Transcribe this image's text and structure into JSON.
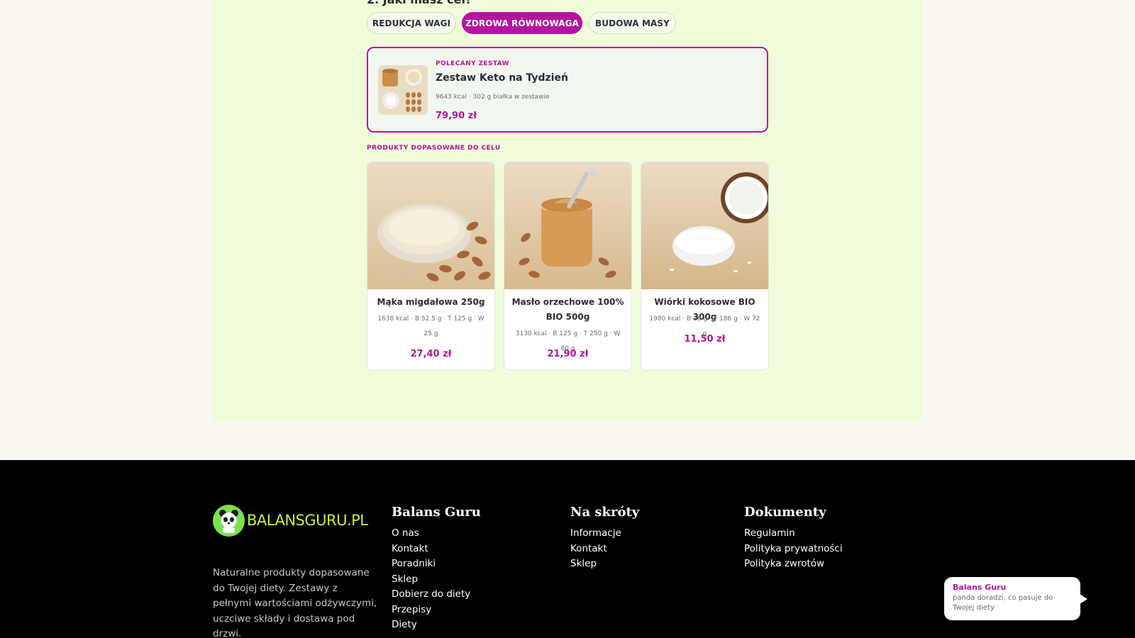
{
  "quiz": {
    "question": "2. Jaki masz cel?",
    "goals": [
      {
        "label": "REDUKCJA WAGI",
        "active": false
      },
      {
        "label": "ZDROWA RÓWNOWAGA",
        "active": true
      },
      {
        "label": "BUDOWA MASY",
        "active": false
      }
    ]
  },
  "featured": {
    "eyebrow": "POLECANY ZESTAW",
    "name": "Zestaw Keto na Tydzień",
    "meta": "9643 kcal · 302 g białka w zestawie",
    "price": "79,90 zł"
  },
  "products_section": {
    "label": "PRODUKTY DOPASOWANE DO CELU",
    "items": [
      {
        "name": "Mąka migdałowa 250g",
        "meta": "1638 kcal · B 52.5 g · T 125 g · W 25 g",
        "price": "27,40 zł",
        "image": "almond-flour-photo"
      },
      {
        "name": "Masło orzechowe 100% BIO 500g",
        "meta": "3130 kcal · B 125 g · T 250 g · W 60 g",
        "price": "21,90 zł",
        "image": "peanut-butter-photo"
      },
      {
        "name": "Wiórki kokosowe BIO 300g",
        "meta": "1980 kcal · B 18 g · T 186 g · W 72 g",
        "price": "11,50 zł",
        "image": "coconut-flakes-photo"
      }
    ]
  },
  "footer": {
    "logo_text": "BALANSGURU.PL",
    "about": "Naturalne produkty dopasowane do Twojej diety. Zestawy z pełnymi wartościami odżywczymi, uczciwe składy i dostawa pod drzwi.",
    "columns": [
      {
        "title": "Balans Guru",
        "links": [
          "O nas",
          "Kontakt",
          "Poradniki",
          "Sklep",
          "Dobierz do diety",
          "Przepisy",
          "Diety"
        ]
      },
      {
        "title": "Na skróty",
        "links": [
          "Informacje",
          "Kontakt",
          "Sklep"
        ]
      },
      {
        "title": "Dokumenty",
        "links": [
          "Regulamin",
          "Polityka prywatności",
          "Polityka zwrotów"
        ]
      }
    ]
  },
  "chat": {
    "title": "Balans Guru",
    "text": "panda doradzi, co pasuje do Twojej diety"
  },
  "colors": {
    "accent": "#b5149f",
    "panel": "#f0fcd9",
    "footer_bg": "#000000",
    "logo_green": "#c8f03a"
  }
}
